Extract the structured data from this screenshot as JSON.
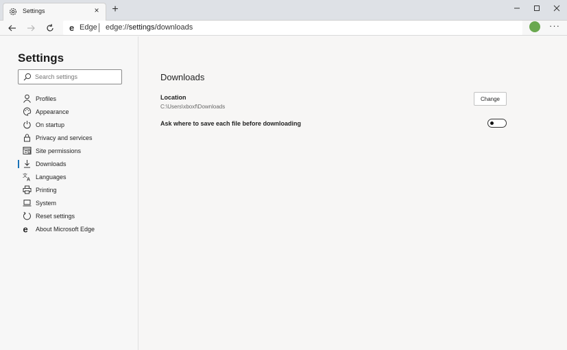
{
  "window": {
    "tab_title": "Settings",
    "tab_close": "×",
    "new_tab": "+",
    "controls": {
      "minimize": "—",
      "maximize": "☐",
      "close": "✕"
    }
  },
  "address_bar": {
    "site_label": "Edge",
    "url_prefix": "edge://",
    "url_bold": "settings",
    "url_suffix": "/downloads",
    "more_label": "···"
  },
  "sidebar": {
    "title": "Settings",
    "search_placeholder": "Search settings",
    "items": [
      {
        "label": "Profiles",
        "icon": "person-icon"
      },
      {
        "label": "Appearance",
        "icon": "palette-icon"
      },
      {
        "label": "On startup",
        "icon": "power-icon"
      },
      {
        "label": "Privacy and services",
        "icon": "lock-icon"
      },
      {
        "label": "Site permissions",
        "icon": "site-permissions-icon"
      },
      {
        "label": "Downloads",
        "icon": "download-icon",
        "active": true
      },
      {
        "label": "Languages",
        "icon": "languages-icon"
      },
      {
        "label": "Printing",
        "icon": "printer-icon"
      },
      {
        "label": "System",
        "icon": "laptop-icon"
      },
      {
        "label": "Reset settings",
        "icon": "reset-icon"
      },
      {
        "label": "About Microsoft Edge",
        "icon": "edge-logo-icon"
      }
    ]
  },
  "main": {
    "section_title": "Downloads",
    "location_label": "Location",
    "location_path": "C:\\Users\\xboxf\\Downloads",
    "change_button": "Change",
    "ask_label": "Ask where to save each file before downloading",
    "ask_enabled": false
  },
  "colors": {
    "accent": "#1a73b8",
    "page_bg": "#f7f6f5",
    "titlebar_bg": "#dee1e6"
  }
}
